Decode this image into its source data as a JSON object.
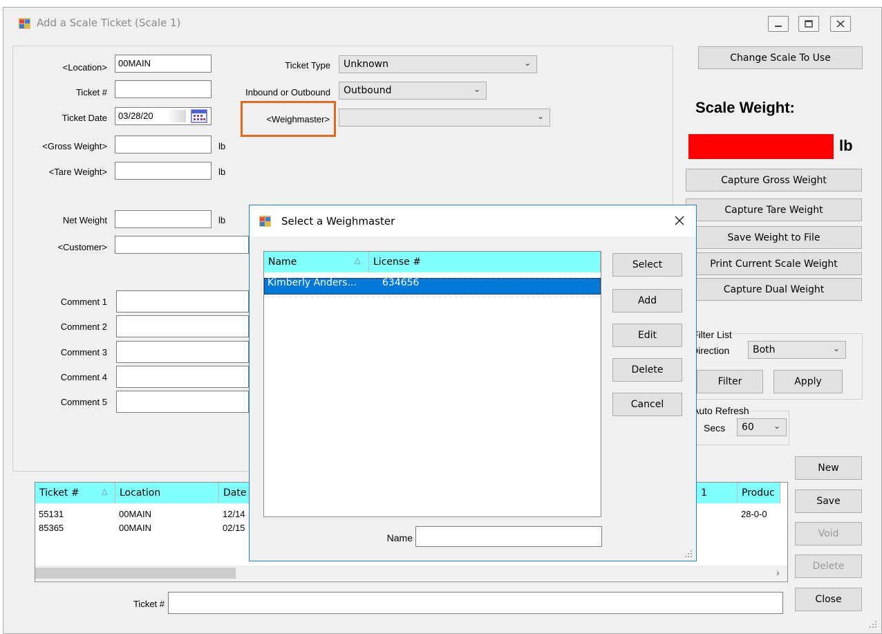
{
  "window": {
    "title": "Add a Scale Ticket (Scale 1)"
  },
  "form": {
    "location_label": "<Location>",
    "location_value": "00MAIN",
    "ticket_label": "Ticket #",
    "ticket_value": "",
    "ticket_date_label": "Ticket Date",
    "ticket_date_value": "03/28/20",
    "gross_label": "<Gross Weight>",
    "tare_label": "<Tare Weight>",
    "net_label": "Net Weight",
    "unit": "lb",
    "customer_label": "<Customer>",
    "ticket_type_label": "Ticket Type",
    "ticket_type_value": "Unknown",
    "inout_label": "Inbound or Outbound",
    "inout_value": "Outbound",
    "weighmaster_label": "<Weighmaster>",
    "weighmaster_value": "",
    "comments": [
      "Comment 1",
      "Comment 2",
      "Comment 3",
      "Comment 4",
      "Comment 5"
    ]
  },
  "scale": {
    "change_button": "Change Scale To Use",
    "weight_title": "Scale Weight:",
    "weight_unit": "lb",
    "weight_display_color": "#ff0000",
    "buttons": [
      "Capture Gross Weight",
      "Capture Tare Weight",
      "Save Weight to File",
      "Print Current Scale Weight",
      "Capture Dual Weight"
    ]
  },
  "filter": {
    "group_label": "Filter List",
    "direction_label": "Direction",
    "direction_value": "Both",
    "filter_button": "Filter",
    "apply_button": "Apply",
    "refresh_label": "Auto Refresh",
    "secs_label": "Secs",
    "secs_value": "60"
  },
  "actions": {
    "new": "New",
    "save": "Save",
    "void": "Void",
    "delete": "Delete",
    "close": "Close"
  },
  "grid": {
    "columns": [
      "Ticket #",
      "Location",
      "Date",
      "1",
      "Produc"
    ],
    "rows": [
      {
        "ticket": "55131",
        "location": "00MAIN",
        "date": "12/14",
        "product": "28-0-0"
      },
      {
        "ticket": "85365",
        "location": "00MAIN",
        "date": "02/15",
        "product": ""
      }
    ]
  },
  "bottom": {
    "ticket_label": "Ticket #",
    "ticket_value": ""
  },
  "dialog": {
    "title": "Select a Weighmaster",
    "columns": [
      "Name",
      "License #"
    ],
    "rows": [
      {
        "name": "Kimberly Anders...",
        "license": "634656"
      }
    ],
    "buttons": [
      "Select",
      "Add",
      "Edit",
      "Delete",
      "Cancel"
    ],
    "name_label": "Name",
    "name_value": ""
  }
}
